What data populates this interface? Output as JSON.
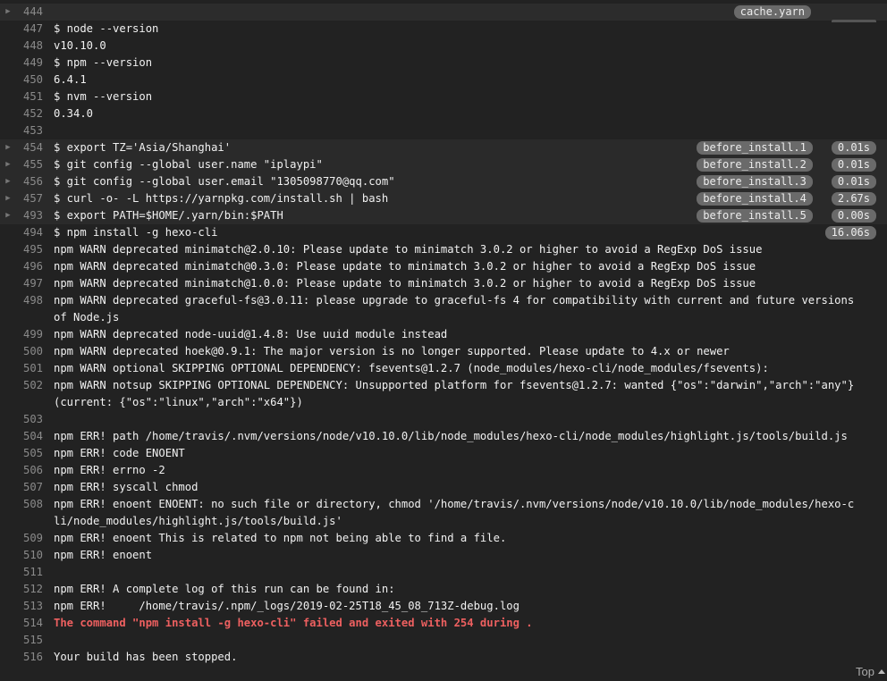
{
  "lines": [
    {
      "n": "444",
      "t": "",
      "fold": true,
      "first": true,
      "cache": "cache.yarn"
    },
    {
      "n": "447",
      "t": "$ node --version"
    },
    {
      "n": "448",
      "t": "v10.10.0"
    },
    {
      "n": "449",
      "t": "$ npm --version"
    },
    {
      "n": "450",
      "t": "6.4.1"
    },
    {
      "n": "451",
      "t": "$ nvm --version"
    },
    {
      "n": "452",
      "t": "0.34.0"
    },
    {
      "n": "453",
      "t": ""
    },
    {
      "n": "454",
      "t": "$ export TZ='Asia/Shanghai'",
      "fold": true,
      "tag": "before_install.1",
      "time": "0.01s"
    },
    {
      "n": "455",
      "t": "$ git config --global user.name \"iplaypi\"",
      "fold": true,
      "tag": "before_install.2",
      "time": "0.01s"
    },
    {
      "n": "456",
      "t": "$ git config --global user.email \"1305098770@qq.com\"",
      "fold": true,
      "tag": "before_install.3",
      "time": "0.01s"
    },
    {
      "n": "457",
      "t": "$ curl -o- -L https://yarnpkg.com/install.sh | bash",
      "fold": true,
      "tag": "before_install.4",
      "time": "2.67s"
    },
    {
      "n": "493",
      "t": "$ export PATH=$HOME/.yarn/bin:$PATH",
      "fold": true,
      "tag": "before_install.5",
      "time": "0.00s"
    },
    {
      "n": "494",
      "t": "$ npm install -g hexo-cli",
      "time": "16.06s"
    },
    {
      "n": "495",
      "t": "npm WARN deprecated minimatch@2.0.10: Please update to minimatch 3.0.2 or higher to avoid a RegExp DoS issue"
    },
    {
      "n": "496",
      "t": "npm WARN deprecated minimatch@0.3.0: Please update to minimatch 3.0.2 or higher to avoid a RegExp DoS issue"
    },
    {
      "n": "497",
      "t": "npm WARN deprecated minimatch@1.0.0: Please update to minimatch 3.0.2 or higher to avoid a RegExp DoS issue"
    },
    {
      "n": "498",
      "t": "npm WARN deprecated graceful-fs@3.0.11: please upgrade to graceful-fs 4 for compatibility with current and future versions of Node.js"
    },
    {
      "n": "499",
      "t": "npm WARN deprecated node-uuid@1.4.8: Use uuid module instead"
    },
    {
      "n": "500",
      "t": "npm WARN deprecated hoek@0.9.1: The major version is no longer supported. Please update to 4.x or newer"
    },
    {
      "n": "501",
      "t": "npm WARN optional SKIPPING OPTIONAL DEPENDENCY: fsevents@1.2.7 (node_modules/hexo-cli/node_modules/fsevents):"
    },
    {
      "n": "502",
      "t": "npm WARN notsup SKIPPING OPTIONAL DEPENDENCY: Unsupported platform for fsevents@1.2.7: wanted {\"os\":\"darwin\",\"arch\":\"any\"} (current: {\"os\":\"linux\",\"arch\":\"x64\"})"
    },
    {
      "n": "503",
      "t": ""
    },
    {
      "n": "504",
      "t": "npm ERR! path /home/travis/.nvm/versions/node/v10.10.0/lib/node_modules/hexo-cli/node_modules/highlight.js/tools/build.js"
    },
    {
      "n": "505",
      "t": "npm ERR! code ENOENT"
    },
    {
      "n": "506",
      "t": "npm ERR! errno -2"
    },
    {
      "n": "507",
      "t": "npm ERR! syscall chmod"
    },
    {
      "n": "508",
      "t": "npm ERR! enoent ENOENT: no such file or directory, chmod '/home/travis/.nvm/versions/node/v10.10.0/lib/node_modules/hexo-cli/node_modules/highlight.js/tools/build.js'"
    },
    {
      "n": "509",
      "t": "npm ERR! enoent This is related to npm not being able to find a file."
    },
    {
      "n": "510",
      "t": "npm ERR! enoent"
    },
    {
      "n": "511",
      "t": ""
    },
    {
      "n": "512",
      "t": "npm ERR! A complete log of this run can be found in:"
    },
    {
      "n": "513",
      "t": "npm ERR!     /home/travis/.npm/_logs/2019-02-25T18_45_08_713Z-debug.log"
    },
    {
      "n": "514",
      "t": "The command \"npm install -g hexo-cli\" failed and exited with 254 during .",
      "err": true
    },
    {
      "n": "515",
      "t": ""
    },
    {
      "n": "516",
      "t": "Your build has been stopped."
    }
  ],
  "footer": {
    "top_label": "Top"
  },
  "colors": {
    "background": "#222222",
    "text": "#f1f1f1",
    "error": "#ee6060",
    "tag_bg": "#6a6a6a",
    "line_number": "#8a8a8a"
  },
  "icons": {
    "fold": "triangle-right-icon",
    "top": "caret-up-icon"
  }
}
